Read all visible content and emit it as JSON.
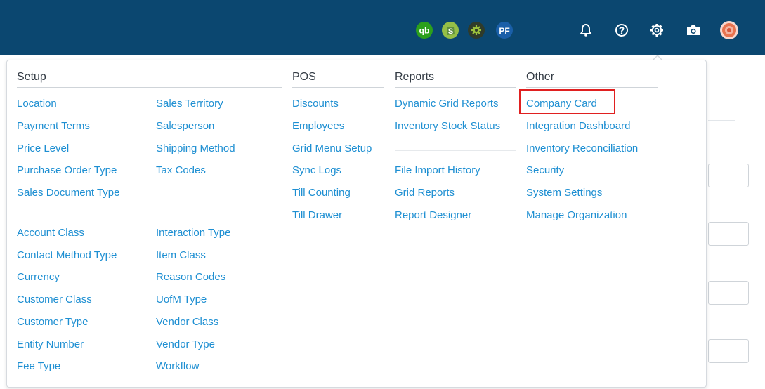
{
  "topbar": {
    "icons": [
      "quickbooks-icon",
      "shopify-icon",
      "extension-gear-icon",
      "pf-icon",
      "bell-icon",
      "help-icon",
      "settings-icon",
      "camera-icon",
      "avatar"
    ],
    "colors": {
      "bar": "#0b4770",
      "quickbooks": "#2ca01c",
      "shopify": "#95bf47",
      "extension": "#5b7d1e",
      "pf": "#1a5fa8"
    },
    "qb_label": "qb",
    "pf_label": "PF"
  },
  "menu": {
    "setup": {
      "title": "Setup",
      "col1_top": [
        "Location",
        "Payment Terms",
        "Price Level",
        "Purchase Order Type",
        "Sales Document Type"
      ],
      "col2_top": [
        "Sales Territory",
        "Salesperson",
        "Shipping Method",
        "Tax Codes"
      ],
      "col1_bottom": [
        "Account Class",
        "Contact Method Type",
        "Currency",
        "Customer Class",
        "Customer Type",
        "Entity Number",
        "Fee Type"
      ],
      "col2_bottom": [
        "Interaction Type",
        "Item Class",
        "Reason Codes",
        "UofM Type",
        "Vendor Class",
        "Vendor Type",
        "Workflow"
      ]
    },
    "pos": {
      "title": "POS",
      "items": [
        "Discounts",
        "Employees",
        "Grid Menu Setup",
        "Sync Logs",
        "Till Counting",
        "Till Drawer"
      ]
    },
    "reports": {
      "title": "Reports",
      "top": [
        "Dynamic Grid Reports",
        "Inventory Stock Status"
      ],
      "bottom": [
        "File Import History",
        "Grid Reports",
        "Report Designer"
      ]
    },
    "other": {
      "title": "Other",
      "items": [
        "Company Card",
        "Integration Dashboard",
        "Inventory Reconciliation",
        "Security",
        "System Settings",
        "Manage Organization"
      ],
      "highlighted": "Company Card"
    },
    "colors": {
      "link": "#1e8fd2",
      "highlight_border": "#e02020",
      "title": "#333b44"
    }
  }
}
